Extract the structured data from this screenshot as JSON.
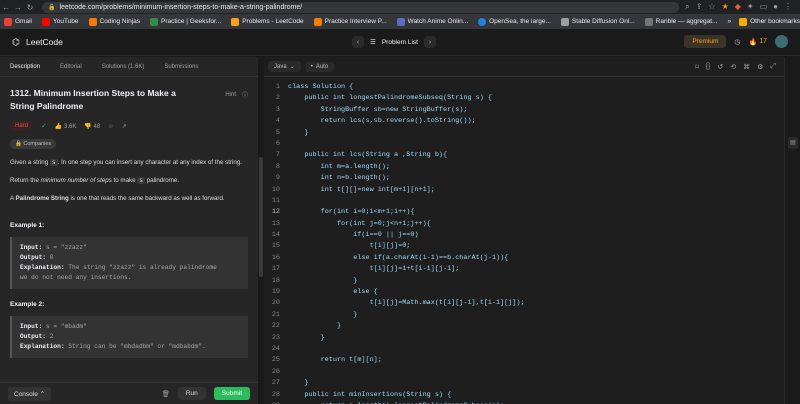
{
  "browser": {
    "url": "leetcode.com/problems/minimum-insertion-steps-to-make-a-string-palindrome/",
    "bookmarks": [
      "Gmail",
      "YouTube",
      "Coding Ninjas",
      "Practice | Geeksfor...",
      "Problems - LeetCode",
      "Practice Interview P...",
      "Watch Anime Onlin...",
      "OpenSea, the large...",
      "Stable Diffusion Onl...",
      "Ranble — aggregat..."
    ],
    "more": "»",
    "other_bookmarks": "Other bookmarks"
  },
  "header": {
    "logo": "LeetCode",
    "problem_list": "Problem List",
    "premium": "Premium",
    "streak": "17"
  },
  "left": {
    "tabs": [
      "Description",
      "Editorial",
      "Solutions (1.6K)",
      "Submissions"
    ],
    "title": "1312. Minimum Insertion Steps to Make a String Palindrome",
    "hint": "Hint",
    "difficulty": "Hard",
    "likes": "3.6K",
    "dislikes": "48",
    "companies": "Companies",
    "desc1_a": "Given a string ",
    "desc1_code": "s",
    "desc1_b": ". In one step you can insert any character at any index of the string.",
    "desc2_a": "Return the ",
    "desc2_em": "minimum number of steps",
    "desc2_b": " to make ",
    "desc2_code": "s",
    "desc2_c": " palindrome.",
    "desc3_a": "A ",
    "desc3_b": "Palindrome String",
    "desc3_c": " is one that reads the same backward as well as forward.",
    "example1": {
      "title": "Example 1:",
      "input_label": "Input:",
      "input": "s = \"zzazz\"",
      "output_label": "Output:",
      "output": "0",
      "expl_label": "Explanation:",
      "expl1": "The string \"zzazz\" is already palindrome",
      "expl2": "we do not need any insertions."
    },
    "example2": {
      "title": "Example 2:",
      "input_label": "Input:",
      "input": "s = \"mbadm\"",
      "output_label": "Output:",
      "output": "2",
      "expl_label": "Explanation:",
      "expl1": "String can be \"mbdadbm\" or \"mdbabdm\"."
    },
    "console": "Console",
    "run": "Run",
    "submit": "Submit"
  },
  "editor": {
    "language": "Java",
    "mode": "Auto",
    "lines": [
      "class Solution {",
      "    public int longestPalindromeSubseq(String s) {",
      "        StringBuffer sb=new StringBuffer(s);",
      "        return lcs(s,sb.reverse().toString());",
      "    }",
      "",
      "    public int lcs(String a ,String b){",
      "        int m=a.length();",
      "        int n=b.length();",
      "        int t[][]=new int[m+1][n+1];",
      "",
      "        for(int i=0;i<m+1;i++){",
      "            for(int j=0;j<n+1;j++){",
      "                if(i==0 || j==0)",
      "                    t[i][j]=0;",
      "                else if(a.charAt(i-1)==b.charAt(j-1)){",
      "                    t[i][j]=1+t[i-1][j-1];",
      "                }",
      "                else {",
      "                    t[i][j]=Math.max(t[i][j-1],t[i-1][j]);",
      "                }",
      "            }",
      "        }",
      "",
      "        return t[m][n];",
      "",
      "    }",
      "    public int minInsertions(String s) {",
      "        return s.length()-longestPalindromeSubseq(s);",
      "    }"
    ],
    "highlight_line": 12
  },
  "colors": {
    "accent": "#ffa116",
    "hard": "#ef4743",
    "submit": "#2cbb5d"
  }
}
